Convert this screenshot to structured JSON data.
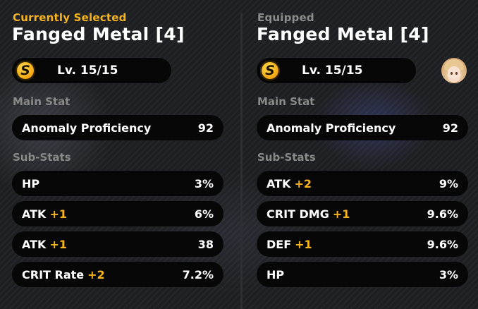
{
  "left_panel": {
    "header": "Currently Selected",
    "item_name": "Fanged Metal [4]",
    "badge": "S",
    "level": "Lv. 15/15",
    "main_stat_label": "Main Stat",
    "main_stat": {
      "name": "Anomaly Proficiency",
      "value": "92"
    },
    "sub_stats_label": "Sub-Stats",
    "sub_stats": [
      {
        "name": "HP",
        "roll": "",
        "value": "3%"
      },
      {
        "name": "ATK",
        "roll": "+1",
        "value": "6%"
      },
      {
        "name": "ATK",
        "roll": "+1",
        "value": "38"
      },
      {
        "name": "CRIT Rate",
        "roll": "+2",
        "value": "7.2%"
      }
    ]
  },
  "right_panel": {
    "header": "Equipped",
    "item_name": "Fanged Metal [4]",
    "badge": "S",
    "level": "Lv. 15/15",
    "avatar": "character-portrait-icon",
    "main_stat_label": "Main Stat",
    "main_stat": {
      "name": "Anomaly Proficiency",
      "value": "92"
    },
    "sub_stats_label": "Sub-Stats",
    "sub_stats": [
      {
        "name": "ATK",
        "roll": "+2",
        "value": "9%"
      },
      {
        "name": "CRIT DMG",
        "roll": "+1",
        "value": "9.6%"
      },
      {
        "name": "DEF",
        "roll": "+1",
        "value": "9.6%"
      },
      {
        "name": "HP",
        "roll": "",
        "value": "3%"
      }
    ]
  },
  "colors": {
    "accent": "#f6b51e",
    "pill_bg": "#070707",
    "muted": "#8a8a8a"
  }
}
